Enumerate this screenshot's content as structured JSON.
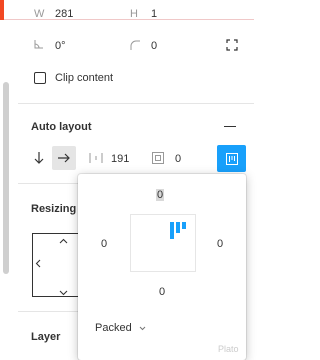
{
  "colors": {
    "accent": "#18a0fb",
    "top_accent": "#f24822",
    "text": "#333333",
    "muted": "#999999"
  },
  "frame": {
    "w_label": "W",
    "w_value": "281",
    "h_label": "H",
    "h_value": "1",
    "rotation_value": "0°",
    "corner_radius_value": "0",
    "clip_content_label": "Clip content",
    "clip_content_checked": false
  },
  "auto_layout": {
    "title": "Auto layout",
    "direction_selected": "horizontal",
    "spacing_value": "191",
    "padding_value": "0"
  },
  "padding_popover": {
    "top": "0",
    "left": "0",
    "right": "0",
    "bottom": "0",
    "mode_label": "Packed"
  },
  "resizing": {
    "title": "Resizing"
  },
  "layer": {
    "title": "Layer"
  },
  "watermark": "Plato"
}
